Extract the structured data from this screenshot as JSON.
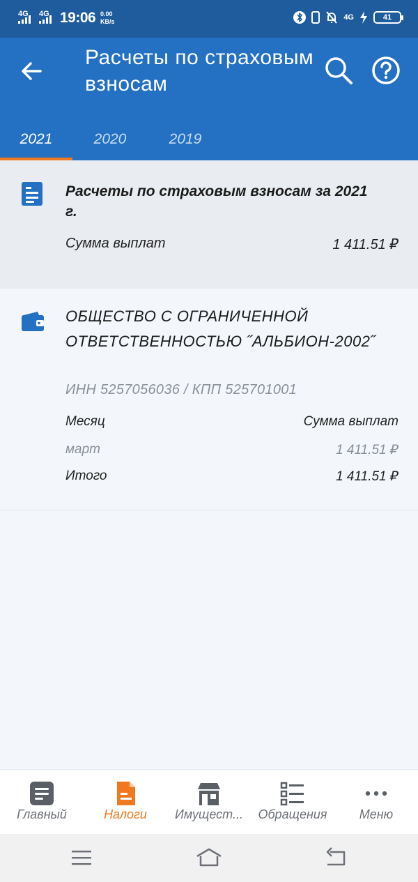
{
  "status_bar": {
    "network_1": "4G",
    "network_2": "4G",
    "time": "19:06",
    "speed_value": "0.00",
    "speed_unit": "KB/s",
    "network_3": "4G",
    "battery": "41"
  },
  "app_bar": {
    "title": "Расчеты по страховым взносам",
    "tabs": [
      {
        "label": "2021",
        "active": true
      },
      {
        "label": "2020",
        "active": false
      },
      {
        "label": "2019",
        "active": false
      }
    ]
  },
  "summary": {
    "title": "Расчеты по страховым взносам за 2021 г.",
    "label": "Сумма выплат",
    "value": "1 411.51 ₽"
  },
  "organization": {
    "name": "ОБЩЕСТВО С ОГРАНИЧЕННОЙ ОТВЕТСТВЕННОСТЬЮ ˝АЛЬБИОН-2002˝",
    "ids": "ИНН 5257056036 / КПП 525701001",
    "table": {
      "header": {
        "month": "Месяц",
        "amount": "Сумма выплат"
      },
      "rows": [
        {
          "month": "март",
          "amount": "1 411.51 ₽"
        }
      ],
      "total": {
        "label": "Итого",
        "amount": "1 411.51 ₽"
      }
    }
  },
  "bottom_nav": [
    {
      "label": "Главный",
      "icon": "document-lines-icon",
      "active": false
    },
    {
      "label": "Налоги",
      "icon": "tax-document-icon",
      "active": true
    },
    {
      "label": "Имущест...",
      "icon": "property-building-icon",
      "active": false
    },
    {
      "label": "Обращения",
      "icon": "list-icon",
      "active": false
    },
    {
      "label": "Меню",
      "icon": "more-dots-icon",
      "active": false
    }
  ],
  "colors": {
    "primary": "#2470c2",
    "status_bar": "#1f5c9e",
    "accent": "#f07820",
    "nav_icon": "#5a5f66"
  }
}
